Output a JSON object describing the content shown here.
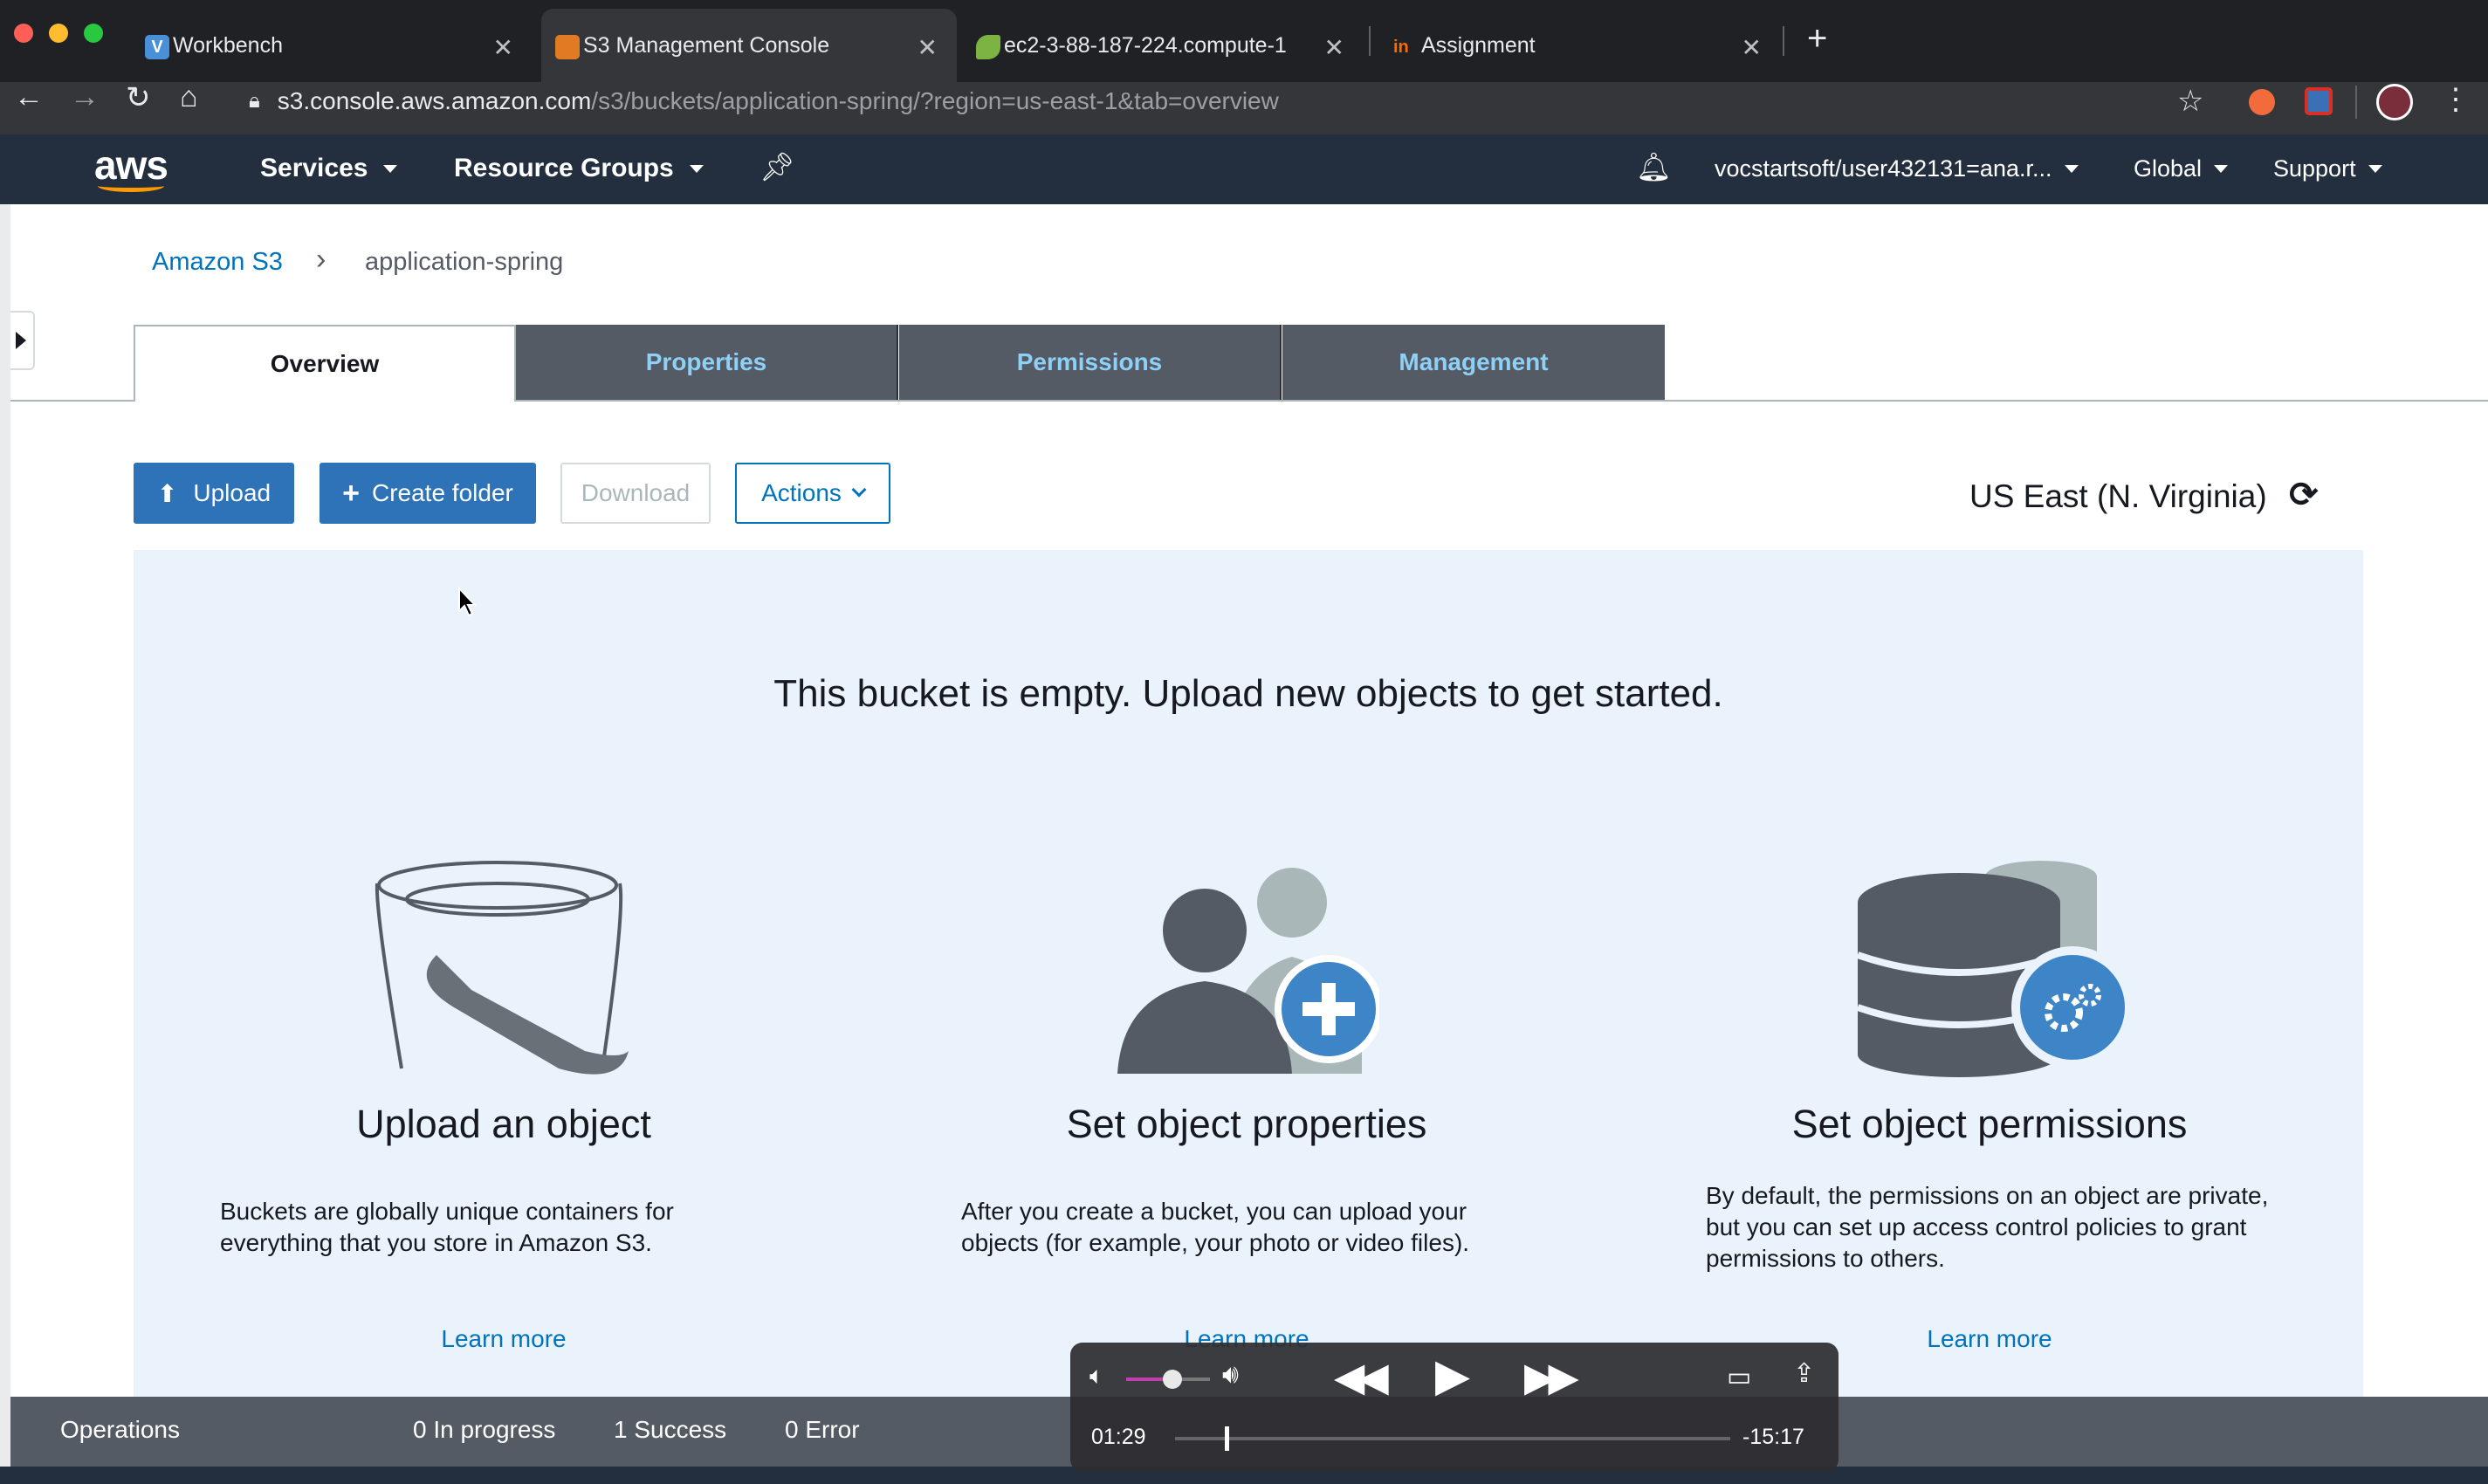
{
  "browser": {
    "tabs": [
      {
        "title": "Workbench",
        "favicon_color": "#4a90d9",
        "favicon_letter": "V"
      },
      {
        "title": "S3 Management Console",
        "favicon_color": "#e07b24",
        "favicon_letter": ""
      },
      {
        "title": "ec2-3-88-187-224.compute-1",
        "favicon_color": "#7cb342",
        "favicon_letter": ""
      },
      {
        "title": "Assignment",
        "favicon_color": "#ff6a00",
        "favicon_letter": "in"
      }
    ],
    "new_tab": "+",
    "url_host": "s3.console.aws.amazon.com",
    "url_path": "/s3/buckets/application-spring/?region=us-east-1&tab=overview"
  },
  "aws_header": {
    "logo": "aws",
    "services": "Services",
    "resource_groups": "Resource Groups",
    "account": "vocstartsoft/user432131=ana.r...",
    "region_menu": "Global",
    "support": "Support"
  },
  "breadcrumb": {
    "root": "Amazon S3",
    "separator": "›",
    "current": "application-spring"
  },
  "tabs": [
    "Overview",
    "Properties",
    "Permissions",
    "Management"
  ],
  "toolbar": {
    "upload": "Upload",
    "create_folder": "Create folder",
    "download": "Download",
    "actions": "Actions",
    "region": "US East (N. Virginia)"
  },
  "empty_state": {
    "message": "This bucket is empty. Upload new objects to get started.",
    "cards": [
      {
        "icon": "bucket-icon",
        "title": "Upload an object",
        "description": "Buckets are globally unique containers for everything that you store in Amazon S3.",
        "link": "Learn more"
      },
      {
        "icon": "users-add-icon",
        "title": "Set object properties",
        "description": "After you create a bucket, you can upload your objects (for example, your photo or video files).",
        "link": "Learn more"
      },
      {
        "icon": "database-gear-icon",
        "title": "Set object permissions",
        "description": "By default, the permissions on an object are private, but you can set up access control policies to grant permissions to others.",
        "link": "Learn more"
      }
    ]
  },
  "operations": {
    "label": "Operations",
    "in_progress": "0 In progress",
    "success": "1 Success",
    "error": "0 Error"
  },
  "player": {
    "elapsed": "01:29",
    "remaining": "-15:17",
    "progress": 0.089,
    "volume": 0.55
  },
  "colors": {
    "aws_nav": "#232f3e",
    "tab_inactive": "#545b64",
    "tab_text": "#8fd0f7",
    "primary": "#2e73b8",
    "link": "#0073bb",
    "panel": "#eaf3fb"
  }
}
